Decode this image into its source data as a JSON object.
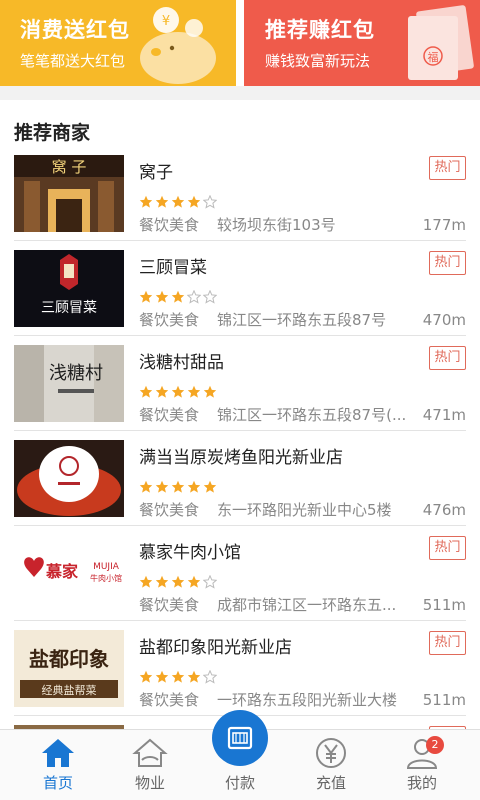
{
  "promos": [
    {
      "title": "消费送红包",
      "subtitle": "笔笔都送大红包",
      "color": "#f7b928"
    },
    {
      "title": "推荐赚红包",
      "subtitle": "赚钱致富新玩法",
      "color": "#ef5b4b"
    }
  ],
  "section_title": "推荐商家",
  "hot_label": "热门",
  "merchants": [
    {
      "name": "窝子",
      "hot": true,
      "rating": 4,
      "category": "餐饮美食",
      "address": "较场坝东街103号",
      "distance": "177m"
    },
    {
      "name": "三顾冒菜",
      "hot": true,
      "rating": 3,
      "category": "餐饮美食",
      "address": "锦江区一环路东五段87号",
      "distance": "470m"
    },
    {
      "name": "浅糖村甜品",
      "hot": true,
      "rating": 5,
      "category": "餐饮美食",
      "address": "锦江区一环路东五段87号(...",
      "distance": "471m"
    },
    {
      "name": "满当当原炭烤鱼阳光新业店",
      "hot": false,
      "rating": 5,
      "category": "餐饮美食",
      "address": "东一环路阳光新业中心5楼",
      "distance": "476m"
    },
    {
      "name": "慕家牛肉小馆",
      "hot": true,
      "rating": 4,
      "category": "餐饮美食",
      "address": "成都市锦江区一环路东五...",
      "distance": "511m"
    },
    {
      "name": "盐都印象阳光新业店",
      "hot": true,
      "rating": 4,
      "category": "餐饮美食",
      "address": "一环路东五段阳光新业大楼",
      "distance": "511m"
    }
  ],
  "thumb_text": {
    "wozi": "窝 子",
    "sangu": "三顾冒菜",
    "qiantang": "浅糖村",
    "mujia": "慕家",
    "mujia_en": "MUJIA",
    "mujia_sub": "牛肉小馆",
    "yandu": "盐都印象",
    "yandu_sub": "经典盐帮菜"
  },
  "nav": {
    "items": [
      {
        "label": "首页",
        "icon": "home-icon",
        "active": true
      },
      {
        "label": "物业",
        "icon": "property-icon",
        "active": false
      },
      {
        "label": "付款",
        "icon": "pay-card-icon",
        "active": false
      },
      {
        "label": "充值",
        "icon": "yuan-icon",
        "active": false
      },
      {
        "label": "我的",
        "icon": "user-icon",
        "active": false,
        "badge": "2"
      }
    ],
    "accent": "#1976d2"
  },
  "colors": {
    "star": "#f5a623",
    "hot": "#e06a5a"
  }
}
